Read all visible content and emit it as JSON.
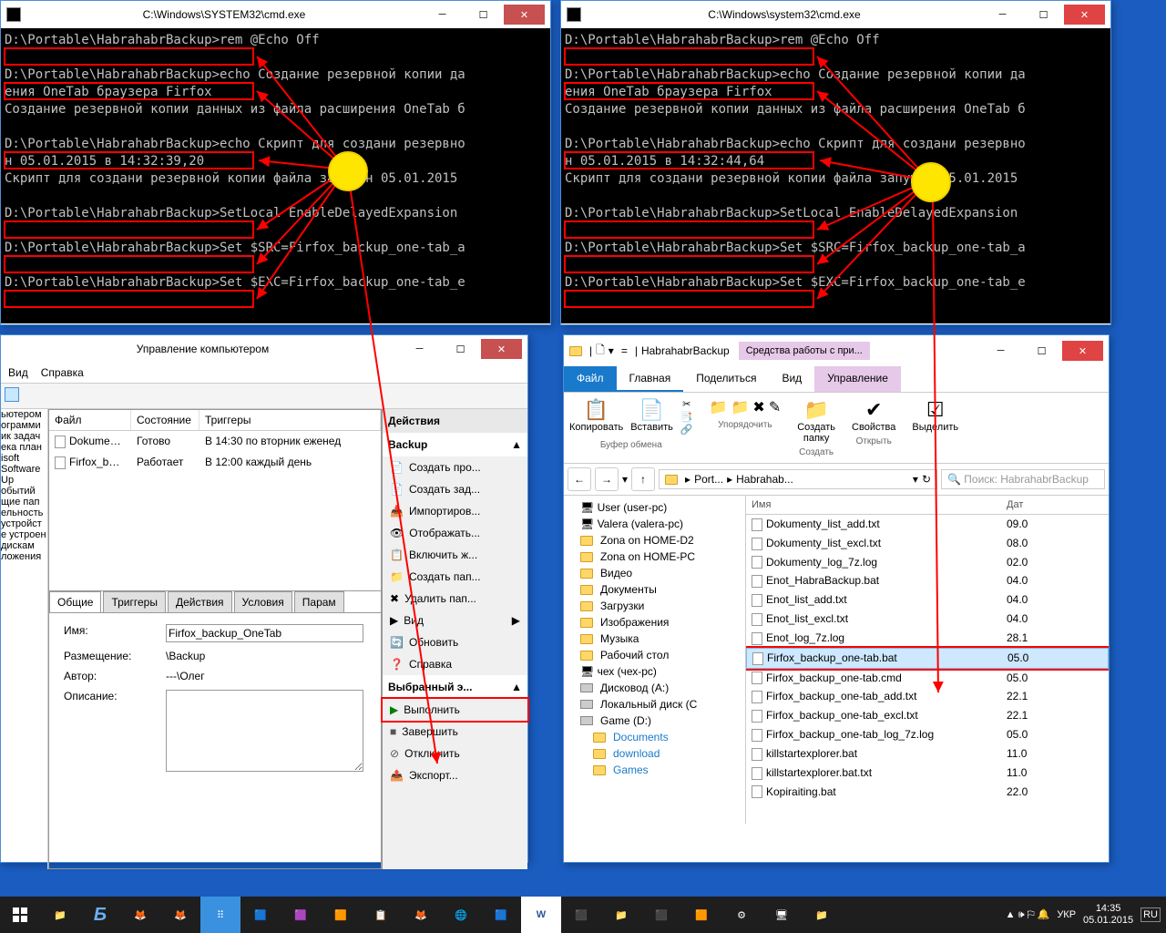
{
  "cmd_left": {
    "title": "C:\\Windows\\SYSTEM32\\cmd.exe",
    "lines": [
      "D:\\Portable\\HabrahabrBackup>rem @Echo Off",
      "",
      "D:\\Portable\\HabrahabrBackup>echo Создание резервной копии да",
      "ения OneTab браузера Firfox",
      "Создание резервной копии данных из файла расширения OneTab б",
      "",
      "D:\\Portable\\HabrahabrBackup>echo Скрипт для создани резервно",
      "н 05.01.2015 в 14:32:39,20",
      "Скрипт для создани резервной копии файла запушен 05.01.2015",
      "",
      "D:\\Portable\\HabrahabrBackup>SetLocal EnableDelayedExpansion",
      "",
      "D:\\Portable\\HabrahabrBackup>Set $SRC=Firfox_backup_one-tab_a",
      "",
      "D:\\Portable\\HabrahabrBackup>Set $EXC=Firfox_backup_one-tab_e"
    ]
  },
  "cmd_right": {
    "title": "C:\\Windows\\system32\\cmd.exe",
    "lines": [
      "D:\\Portable\\HabrahabrBackup>rem @Echo Off",
      "",
      "D:\\Portable\\HabrahabrBackup>echo Создание резервной копии да",
      "ения OneTab браузера Firfox",
      "Создание резервной копии данных из файла расширения OneTab б",
      "",
      "D:\\Portable\\HabrahabrBackup>echo Скрипт для создани резервно",
      "н 05.01.2015 в 14:32:44,64",
      "Скрипт для создани резервной копии файла запушен 05.01.2015",
      "",
      "D:\\Portable\\HabrahabrBackup>SetLocal EnableDelayedExpansion",
      "",
      "D:\\Portable\\HabrahabrBackup>Set $SRC=Firfox_backup_one-tab_a",
      "",
      "D:\\Portable\\HabrahabrBackup>Set $EXC=Firfox_backup_one-tab_e"
    ]
  },
  "mgmt": {
    "title": "Управление компьютером",
    "menu": {
      "view": "Вид",
      "help": "Справка"
    },
    "cols": {
      "file": "Файл",
      "state": "Состояние",
      "trigger": "Триггеры"
    },
    "tasks": [
      {
        "file": "Dokument...",
        "state": "Готово",
        "trigger": "В 14:30 по вторник еженед"
      },
      {
        "file": "Firfox_back...",
        "state": "Работает",
        "trigger": "В 12:00 каждый день"
      }
    ],
    "actions_hdr": "Действия",
    "actions_sub": "Backup",
    "actions": [
      "Создать про...",
      "Создать зад...",
      "Импортиров...",
      "Отображать...",
      "Включить ж...",
      "Создать пап...",
      "Удалить пап...",
      "Вид",
      "Обновить",
      "Справка"
    ],
    "sel_hdr": "Выбранный э...",
    "sel_actions": [
      "Выполнить",
      "Завершить",
      "Отключить",
      "Экспорт..."
    ],
    "tabs": [
      "Общие",
      "Триггеры",
      "Действия",
      "Условия",
      "Парам"
    ],
    "props": {
      "name_lbl": "Имя:",
      "name_val": "Firfox_backup_OneTab",
      "loc_lbl": "Размещение:",
      "loc_val": "\\Backup",
      "auth_lbl": "Автор:",
      "auth_val": "---\\Олег",
      "desc_lbl": "Описание:"
    },
    "side": [
      "ьютером",
      "ограмми",
      "ик задач",
      "ека план",
      "",
      "isoft",
      "Software",
      "",
      "Up",
      "",
      "обытий",
      "щие пап",
      "",
      "ельность",
      "устройст",
      "е устроен",
      "дискам",
      "",
      "ложения"
    ]
  },
  "explorer": {
    "title": "HabrahabrBackup",
    "title_sub": "Средства работы с при...",
    "ribbon_tabs": {
      "file": "Файл",
      "home": "Главная",
      "share": "Поделиться",
      "view": "Вид",
      "mgmt": "Управление"
    },
    "ribbon": {
      "copy": "Копировать",
      "paste": "Вставить",
      "clipboard": "Буфер обмена",
      "organize": "Упорядочить",
      "newfolder": "Создать\nпапку",
      "newgrp": "Создать",
      "props": "Свойства",
      "opengrp": "Открыть",
      "select": "Выделить"
    },
    "crumbs": [
      "Port...",
      "Habrahab..."
    ],
    "search_ph": "Поиск: HabrahabrBackup",
    "cols": {
      "name": "Имя",
      "date": "Дат"
    },
    "tree": [
      "User (user-pc)",
      "Valera (valera-pc)",
      "Zona on HOME-D2",
      "Zona on HOME-PC",
      "Видео",
      "Документы",
      "Загрузки",
      "Изображения",
      "Музыка",
      "Рабочий стол",
      "чех (чех-pc)",
      "Дисковод (A:)",
      "Локальный диск (C",
      "Game (D:)",
      "Documents",
      "download",
      "Games"
    ],
    "files": [
      {
        "n": "Dokumenty_list_add.txt",
        "d": "09.0"
      },
      {
        "n": "Dokumenty_list_excl.txt",
        "d": "08.0"
      },
      {
        "n": "Dokumenty_log_7z.log",
        "d": "02.0"
      },
      {
        "n": "Enot_HabraBackup.bat",
        "d": "04.0"
      },
      {
        "n": "Enot_list_add.txt",
        "d": "04.0"
      },
      {
        "n": "Enot_list_excl.txt",
        "d": "04.0"
      },
      {
        "n": "Enot_log_7z.log",
        "d": "28.1"
      },
      {
        "n": "Firfox_backup_one-tab.bat",
        "d": "05.0",
        "sel": true
      },
      {
        "n": "Firfox_backup_one-tab.cmd",
        "d": "05.0"
      },
      {
        "n": "Firfox_backup_one-tab_add.txt",
        "d": "22.1"
      },
      {
        "n": "Firfox_backup_one-tab_excl.txt",
        "d": "22.1"
      },
      {
        "n": "Firfox_backup_one-tab_log_7z.log",
        "d": "05.0"
      },
      {
        "n": "killstartexplorer.bat",
        "d": "11.0"
      },
      {
        "n": "killstartexplorer.bat.txt",
        "d": "11.0"
      },
      {
        "n": "Kopiraiting.bat",
        "d": "22.0"
      }
    ]
  },
  "taskbar": {
    "lang": "УКР",
    "time": "14:35",
    "date": "05.01.2015",
    "ru": "RU"
  }
}
